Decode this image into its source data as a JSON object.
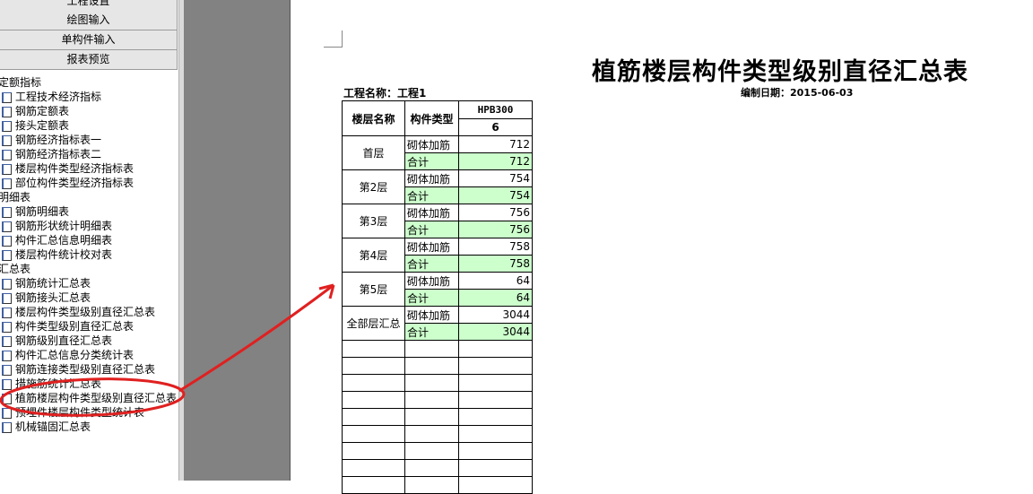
{
  "sidebar": {
    "buttons": [
      "工程设置",
      "绘图输入",
      "单构件输入",
      "报表预览"
    ],
    "groups": [
      {
        "label": "定额指标",
        "items": [
          "工程技术经济指标",
          "钢筋定额表",
          "接头定额表",
          "钢筋经济指标表一",
          "钢筋经济指标表二",
          "楼层构件类型经济指标表",
          "部位构件类型经济指标表"
        ]
      },
      {
        "label": "明细表",
        "items": [
          "钢筋明细表",
          "钢筋形状统计明细表",
          "构件汇总信息明细表",
          "楼层构件统计校对表"
        ]
      },
      {
        "label": "汇总表",
        "items": [
          "钢筋统计汇总表",
          "钢筋接头汇总表",
          "楼层构件类型级别直径汇总表",
          "构件类型级别直径汇总表",
          "钢筋级别直径汇总表",
          "构件汇总信息分类统计表",
          "钢筋连接类型级别直径汇总表",
          "措施筋统计汇总表",
          "植筋楼层构件类型级别直径汇总表",
          "预埋件楼层构件类型统计表",
          "机械锚固汇总表"
        ]
      }
    ]
  },
  "report": {
    "title": "植筋楼层构件类型级别直径汇总表",
    "date": "编制日期：2015-06-03",
    "project": "工程名称：工程1",
    "headers": {
      "floor": "楼层名称",
      "type": "构件类型",
      "grade": "HPB300",
      "diameter": "6"
    },
    "rows": [
      {
        "floor": "首层",
        "type": "砌体加筋",
        "value": "712",
        "total_label": "合计",
        "total": "712"
      },
      {
        "floor": "第2层",
        "type": "砌体加筋",
        "value": "754",
        "total_label": "合计",
        "total": "754"
      },
      {
        "floor": "第3层",
        "type": "砌体加筋",
        "value": "756",
        "total_label": "合计",
        "total": "756"
      },
      {
        "floor": "第4层",
        "type": "砌体加筋",
        "value": "758",
        "total_label": "合计",
        "total": "758"
      },
      {
        "floor": "第5层",
        "type": "砌体加筋",
        "value": "64",
        "total_label": "合计",
        "total": "64"
      },
      {
        "floor": "全部层汇总",
        "type": "砌体加筋",
        "value": "3044",
        "total_label": "合计",
        "total": "3044"
      }
    ]
  },
  "colors": {
    "total_bg": "#ccffcc",
    "annotation": "#e02020"
  }
}
